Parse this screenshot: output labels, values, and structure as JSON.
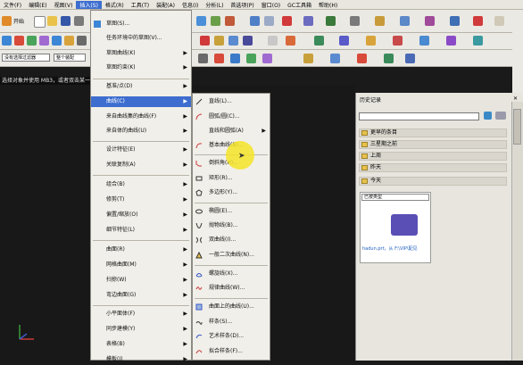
{
  "menubar": {
    "items": [
      "文件(F)",
      "编辑(E)",
      "视图(V)",
      "插入(S)",
      "格式(R)",
      "工具(T)",
      "装配(A)",
      "信息(I)",
      "分析(L)",
      "首选项(P)",
      "窗口(O)",
      "GC工具箱",
      "帮助(H)"
    ],
    "active_index": 3
  },
  "toolbar": {
    "start_label": "开始",
    "filter_value": "没有选择过滤器",
    "assembly_value": "整个装配"
  },
  "status_text": "选择对象并使用 MB3，或者双击某一对象",
  "insert_menu": {
    "items": [
      {
        "label": "草图(S)...",
        "arrow": false
      },
      {
        "label": "任务环境中的草图(V)...",
        "arrow": false
      },
      {
        "label": "草图曲线(K)",
        "arrow": true
      },
      {
        "label": "草图约束(K)",
        "arrow": true
      },
      {
        "label": "基准/点(D)",
        "arrow": true
      },
      {
        "label": "曲线(C)",
        "arrow": true,
        "highlight": true
      },
      {
        "label": "来自曲线集的曲线(F)",
        "arrow": true
      },
      {
        "label": "来自体的曲线(U)",
        "arrow": true
      },
      {
        "label": "设计特征(E)",
        "arrow": true
      },
      {
        "label": "关联复制(A)",
        "arrow": true
      },
      {
        "label": "组合(B)",
        "arrow": true
      },
      {
        "label": "修剪(T)",
        "arrow": true
      },
      {
        "label": "偏置/缩放(O)",
        "arrow": true
      },
      {
        "label": "细节特征(L)",
        "arrow": true
      },
      {
        "label": "曲面(R)",
        "arrow": true
      },
      {
        "label": "网格曲面(M)",
        "arrow": true
      },
      {
        "label": "扫掠(W)",
        "arrow": true
      },
      {
        "label": "弯边曲面(G)",
        "arrow": true
      },
      {
        "label": "小平面体(F)",
        "arrow": true
      },
      {
        "label": "同步建模(Y)",
        "arrow": true
      },
      {
        "label": "表格(B)",
        "arrow": true
      },
      {
        "label": "模板(I)",
        "arrow": true
      }
    ]
  },
  "curve_menu": {
    "items": [
      {
        "label": "直线(L)...",
        "arrow": false
      },
      {
        "label": "圆弧/圆(C)...",
        "arrow": false
      },
      {
        "label": "直线和圆弧(A)",
        "arrow": true
      },
      {
        "label": "基本曲线(B)...",
        "arrow": false
      },
      {
        "label": "倒斜角(H)...",
        "arrow": false
      },
      {
        "label": "矩形(R)...",
        "arrow": false
      },
      {
        "label": "多边形(Y)...",
        "arrow": false
      },
      {
        "label": "椭圆(E)...",
        "arrow": false
      },
      {
        "label": "抛物线(B)...",
        "arrow": false
      },
      {
        "label": "双曲线(I)...",
        "arrow": false
      },
      {
        "label": "一般二次曲线(N)...",
        "arrow": false
      },
      {
        "label": "螺旋线(X)...",
        "arrow": false
      },
      {
        "label": "规律曲线(W)...",
        "arrow": false
      },
      {
        "label": "曲面上的曲线(U)...",
        "arrow": false
      },
      {
        "label": "样条(S)...",
        "arrow": false
      },
      {
        "label": "艺术样条(D)...",
        "arrow": false
      },
      {
        "label": "拟合样条(F)...",
        "arrow": false
      }
    ]
  },
  "history": {
    "title": "历史记录",
    "groups": [
      "更早的条目",
      "三星期之前",
      "上周",
      "昨天",
      "今天"
    ],
    "view_mode": "已按类型",
    "thumb_caption": "hadun.prt，从 F:\\VIP\\配见"
  },
  "colors": {
    "highlight": "#3d6ecf",
    "cursor_ring": "#f5e428",
    "viewport": "#181818"
  }
}
